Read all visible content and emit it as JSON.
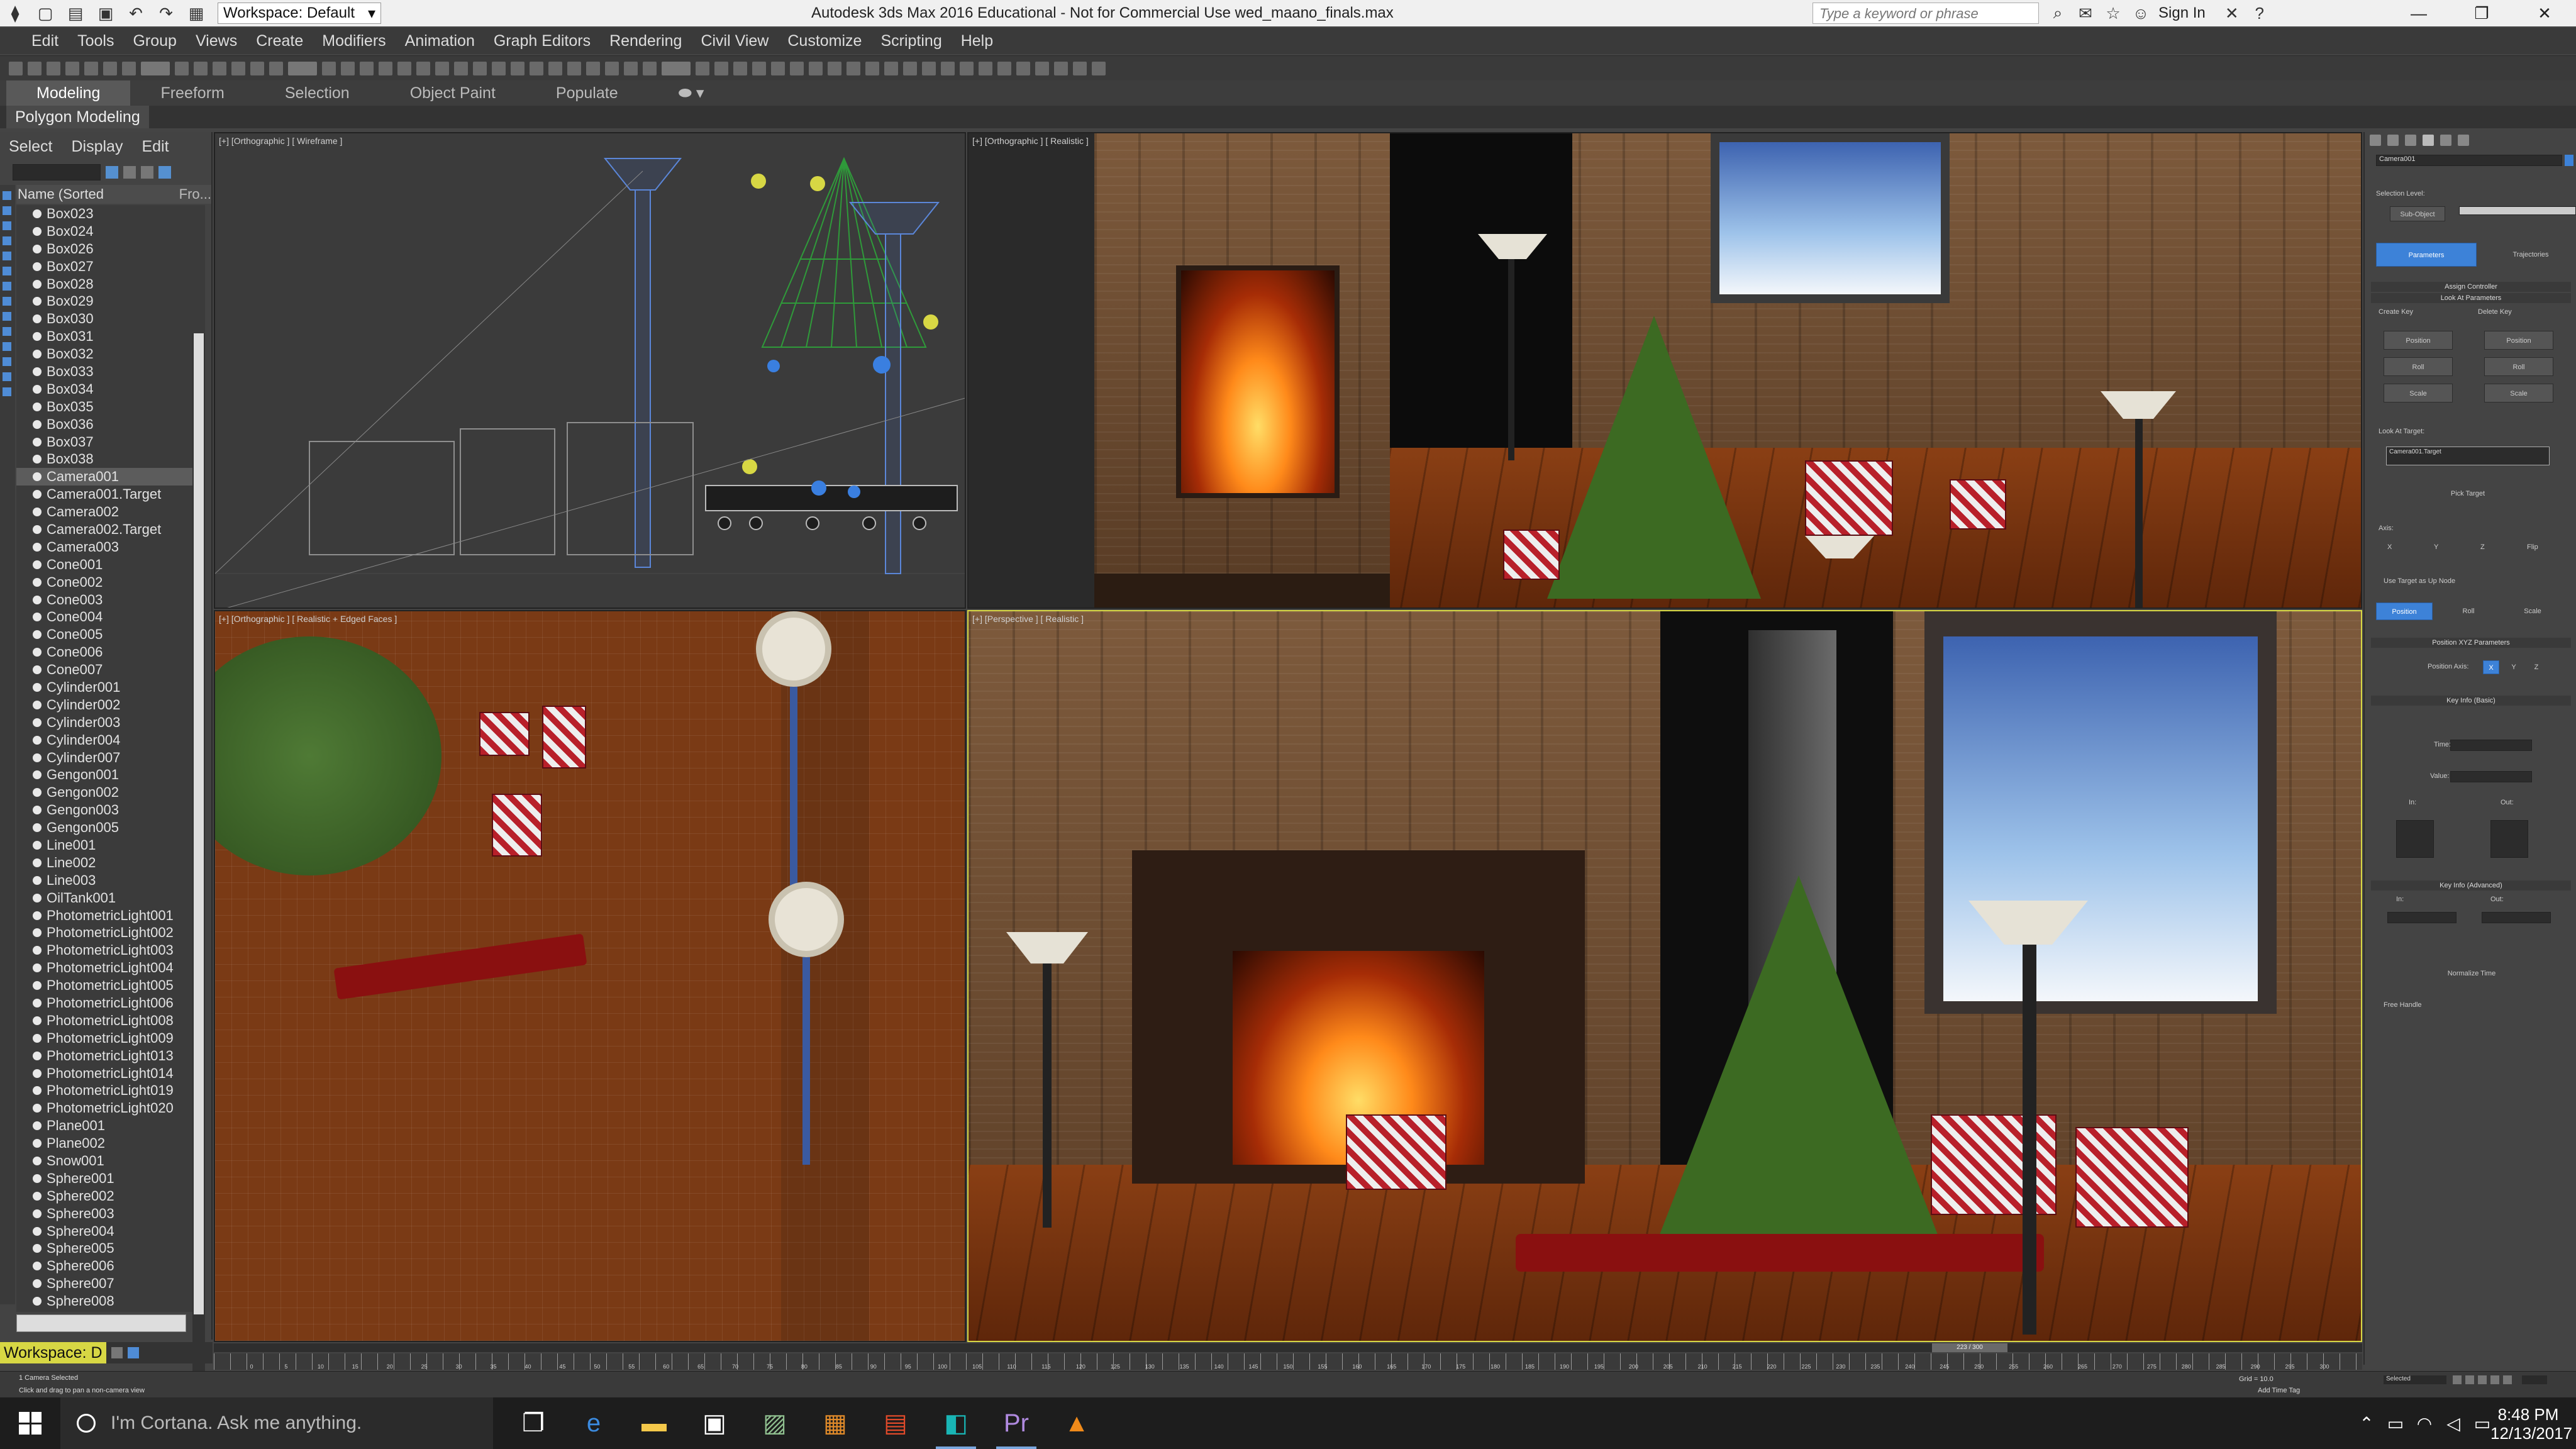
{
  "titlebar": {
    "workspace_label": "Workspace: Default",
    "app_title": "Autodesk 3ds Max 2016 Educational - Not for Commercial Use     wed_maano_finals.max",
    "search_placeholder": "Type a keyword or phrase",
    "sign_in": "Sign In"
  },
  "menu": [
    "Edit",
    "Tools",
    "Group",
    "Views",
    "Create",
    "Modifiers",
    "Animation",
    "Graph Editors",
    "Rendering",
    "Civil View",
    "Customize",
    "Scripting",
    "Help"
  ],
  "ribbon": {
    "tabs": [
      "Modeling",
      "Freeform",
      "Selection",
      "Object Paint",
      "Populate"
    ],
    "active_tab": "Modeling",
    "sub_label": "Polygon Modeling"
  },
  "explorer": {
    "menu": [
      "Select",
      "Display",
      "Edit"
    ],
    "col_name": "Name (Sorted Ascending)",
    "col_other": "Fro...",
    "items": [
      "Box023",
      "Box024",
      "Box026",
      "Box027",
      "Box028",
      "Box029",
      "Box030",
      "Box031",
      "Box032",
      "Box033",
      "Box034",
      "Box035",
      "Box036",
      "Box037",
      "Box038",
      "Camera001",
      "Camera001.Target",
      "Camera002",
      "Camera002.Target",
      "Camera003",
      "Cone001",
      "Cone002",
      "Cone003",
      "Cone004",
      "Cone005",
      "Cone006",
      "Cone007",
      "Cylinder001",
      "Cylinder002",
      "Cylinder003",
      "Cylinder004",
      "Cylinder007",
      "Gengon001",
      "Gengon002",
      "Gengon003",
      "Gengon005",
      "Line001",
      "Line002",
      "Line003",
      "OilTank001",
      "PhotometricLight001",
      "PhotometricLight002",
      "PhotometricLight003",
      "PhotometricLight004",
      "PhotometricLight005",
      "PhotometricLight006",
      "PhotometricLight008",
      "PhotometricLight009",
      "PhotometricLight013",
      "PhotometricLight014",
      "PhotometricLight019",
      "PhotometricLight020",
      "Plane001",
      "Plane002",
      "Snow001",
      "Sphere001",
      "Sphere002",
      "Sphere003",
      "Sphere004",
      "Sphere005",
      "Sphere006",
      "Sphere007",
      "Sphere008"
    ],
    "selected": "Camera001",
    "workspace_bottom": "Workspace: D"
  },
  "viewports": {
    "top_left": "[+] [Orthographic ] [ Wireframe ]",
    "top_right": "[+] [Orthographic ] [ Realistic ]",
    "bottom_left": "[+] [Orthographic ] [ Realistic + Edged Faces ]",
    "bottom_right": "[+] [Perspective ] [ Realistic ]"
  },
  "cmdpanel": {
    "object_name": "Camera001",
    "selection_level": "Selection Level:",
    "sub_object": "Sub-Object",
    "parameters": "Parameters",
    "trajectories": "Trajectories",
    "assign_controller": "Assign Controller",
    "look_at_params": "Look At Parameters",
    "create_key": "Create Key",
    "delete_key": "Delete Key",
    "position": "Position",
    "roll": "Roll",
    "scale": "Scale",
    "look_at_target": "Look At Target:",
    "target_value": "Camera001.Target",
    "pick_target": "Pick Target",
    "axis": "Axis:",
    "flip": "Flip",
    "use_target_up": "Use Target as Up Node",
    "position_xyz": "Position XYZ Parameters",
    "position_axis": "Position Axis:",
    "x": "X",
    "y": "Y",
    "z": "Z",
    "key_info_basic": "Key Info (Basic)",
    "time": "Time:",
    "value": "Value:",
    "in": "In:",
    "out": "Out:",
    "key_info_adv": "Key Info (Advanced)",
    "normalize_time": "Normalize Time",
    "free_handle": "Free Handle"
  },
  "timeline": {
    "thumb": "223 / 300",
    "ticks": [
      "0",
      "5",
      "10",
      "15",
      "20",
      "25",
      "30",
      "35",
      "40",
      "45",
      "50",
      "55",
      "60",
      "65",
      "70",
      "75",
      "80",
      "85",
      "90",
      "95",
      "100",
      "105",
      "110",
      "115",
      "120",
      "125",
      "130",
      "135",
      "140",
      "145",
      "150",
      "155",
      "160",
      "165",
      "170",
      "175",
      "180",
      "185",
      "190",
      "195",
      "200",
      "205",
      "210",
      "215",
      "220",
      "225",
      "230",
      "235",
      "240",
      "245",
      "250",
      "255",
      "260",
      "265",
      "270",
      "275",
      "280",
      "285",
      "290",
      "295",
      "300"
    ]
  },
  "status": {
    "selected": "1 Camera Selected",
    "prompt": "Click and drag to pan a non-camera view",
    "grid": "Grid = 10.0",
    "add_time_tag": "Add Time Tag",
    "key_filter": "Selected"
  },
  "taskbar": {
    "cortana": "I'm Cortana. Ask me anything.",
    "time": "8:48 PM",
    "date": "12/13/2017"
  }
}
